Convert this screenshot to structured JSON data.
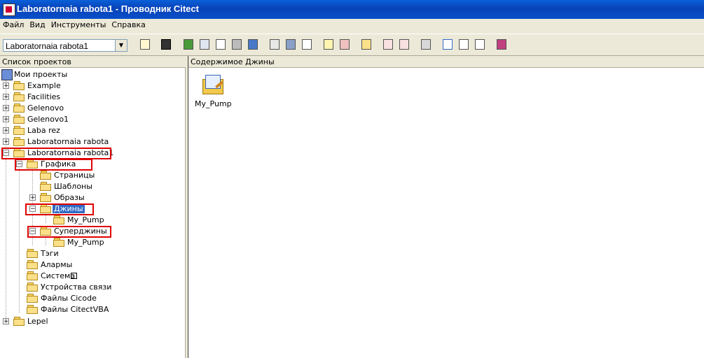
{
  "window": {
    "title": "Laboratornaia rabota1 - Проводник Citect"
  },
  "menu": [
    "Файл",
    "Вид",
    "Инструменты",
    "Справка"
  ],
  "toolbar": {
    "project_combo": "Laboratornaia rabota1"
  },
  "left_panel": {
    "header": "Список проектов"
  },
  "right_panel": {
    "header": "Содержимое Джины"
  },
  "tree": {
    "root": "Мои проекты",
    "example": "Example",
    "facilities": "Facilities",
    "gelenovo": "Gelenovo",
    "gelenovo1": "Gelenovo1",
    "laba_rez": "Laba rez",
    "lab_rabota": "Laboratornaia rabota",
    "lab_rabota1": "Laboratornaia rabota1",
    "grafika": "Графика",
    "stranitsy": "Страницы",
    "shablony": "Шаблоны",
    "obrazy": "Образы",
    "dzhiny": "Джины",
    "dzhiny_pump": "My_Pump",
    "superdzhiny": "Суперджины",
    "superdzhiny_pump": "My_Pump",
    "tegi": "Тэги",
    "alarmy": "Алармы",
    "sistema": "Система",
    "ustroystva": "Устройства связи",
    "cicode": "Файлы Cicode",
    "citectvba": "Файлы CitectVBA",
    "lepel": "Lepel"
  },
  "content_items": [
    {
      "label": "My_Pump",
      "icon": "genie-icon"
    }
  ],
  "colors": {
    "selection": "#316ac5",
    "highlight_box": "#e00000",
    "titlebar": "#0a4fc9"
  }
}
